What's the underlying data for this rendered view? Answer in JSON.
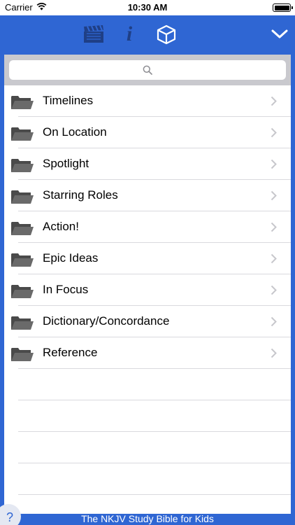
{
  "status_bar": {
    "carrier": "Carrier",
    "time": "10:30 AM",
    "battery_level": 1.0
  },
  "toolbar": {
    "icons": [
      "video-clapper-icon",
      "info-icon",
      "cube-icon",
      "chevron-down-icon"
    ],
    "info_glyph": "i"
  },
  "search": {
    "placeholder": ""
  },
  "list": {
    "items": [
      {
        "label": "Timelines"
      },
      {
        "label": "On Location"
      },
      {
        "label": "Spotlight"
      },
      {
        "label": "Starring Roles"
      },
      {
        "label": "Action!"
      },
      {
        "label": "Epic Ideas"
      },
      {
        "label": "In Focus"
      },
      {
        "label": "Dictionary/Concordance"
      },
      {
        "label": "Reference"
      }
    ]
  },
  "footer": {
    "title": "The NKJV Study Bible for Kids",
    "help_label": "?"
  },
  "colors": {
    "accent": "#2f66d3",
    "folder": "#5a5a5a",
    "chevron": "#c7c7cc"
  }
}
